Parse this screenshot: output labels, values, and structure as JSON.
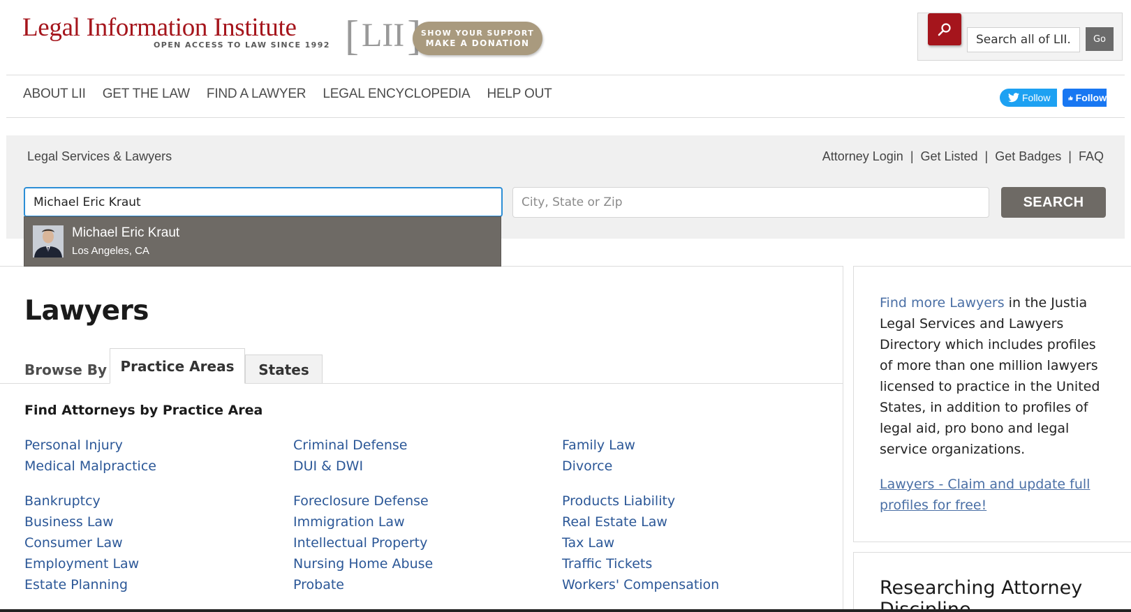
{
  "header": {
    "logo_title": "Legal Information Institute",
    "logo_tagline": "OPEN ACCESS TO LAW SINCE 1992",
    "logo_mark": "LII",
    "donate_line1": "SHOW YOUR SUPPORT",
    "donate_line2": "MAKE A DONATION",
    "search_placeholder": "Search all of LII...",
    "go_label": "Go"
  },
  "nav": {
    "items": [
      "ABOUT LII",
      "GET THE LAW",
      "FIND A LAWYER",
      "LEGAL ENCYCLOPEDIA",
      "HELP OUT"
    ],
    "twitter_label": "Follow",
    "facebook_label": "Follow"
  },
  "search_band": {
    "title": "Legal Services & Lawyers",
    "links": [
      "Attorney Login",
      "Get Listed",
      "Get Badges",
      "FAQ"
    ],
    "name_value": "Michael Eric Kraut",
    "location_placeholder": "City, State or Zip",
    "search_label": "SEARCH",
    "suggestion": {
      "name": "Michael Eric Kraut",
      "location": "Los Angeles, CA"
    }
  },
  "main": {
    "title": "Lawyers",
    "browse_by": "Browse By",
    "tabs": [
      "Practice Areas",
      "States"
    ],
    "section_title": "Find Attorneys by Practice Area",
    "col1_top": [
      "Personal Injury",
      "Medical Malpractice"
    ],
    "col1_bottom": [
      "Bankruptcy",
      "Business Law",
      "Consumer Law",
      "Employment Law",
      "Estate Planning"
    ],
    "col2_top": [
      "Criminal Defense",
      "DUI & DWI"
    ],
    "col2_bottom": [
      "Foreclosure Defense",
      "Immigration Law",
      "Intellectual Property",
      "Nursing Home Abuse",
      "Probate"
    ],
    "col3_top": [
      "Family Law",
      "Divorce"
    ],
    "col3_bottom": [
      "Products Liability",
      "Real Estate Law",
      "Tax Law",
      "Traffic Tickets",
      "Workers' Compensation"
    ]
  },
  "sidebar": {
    "find_more_link": "Find more Lawyers",
    "find_more_text": " in the Justia Legal Services and Lawyers Directory which includes profiles of more than one million lawyers licensed to practice in the United States, in addition to profiles of legal aid, pro bono and legal service organizations.",
    "claim_link": "Lawyers - Claim and update full profiles for free!",
    "research_title": "Researching Attorney",
    "research_title_2": "Discipline"
  },
  "colors": {
    "brand_red": "#a5151c",
    "link_blue": "#2b5797",
    "button_gray": "#6e6a65",
    "focus_blue": "#2c8ed6"
  }
}
